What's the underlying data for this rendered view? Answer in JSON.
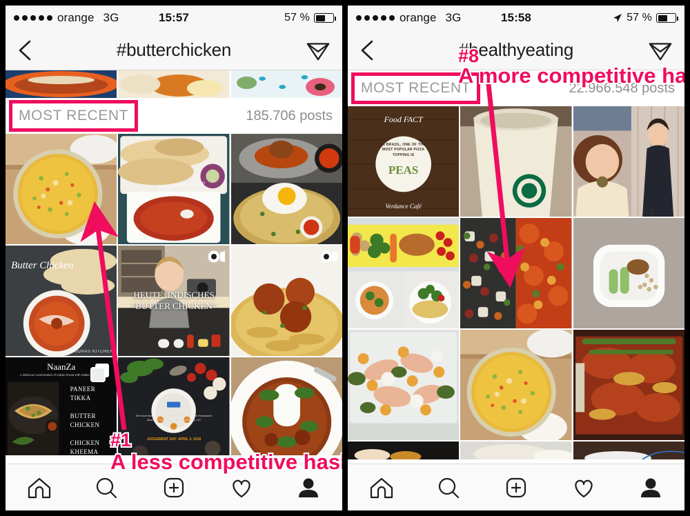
{
  "colors": {
    "accent": "#ef0d5e",
    "bezel": "#000000",
    "chrome": "#f7f7f7",
    "muted_text": "#8e8e8e",
    "tabbar": "#fafafa"
  },
  "panels": [
    {
      "id": "left",
      "status": {
        "signal_dots": 5,
        "carrier": "orange",
        "network": "3G",
        "time": "15:57",
        "battery_percent_label": "57 %",
        "battery_level": 57,
        "location_icon": false
      },
      "nav": {
        "back_icon": "chevron-left-icon",
        "title": "#butterchicken",
        "direct_icon": "paper-plane-icon"
      },
      "section": {
        "label": "MOST RECENT",
        "highlighted": true,
        "post_count": "185.706 posts"
      },
      "grid": [
        [
          {
            "alt": "yellow curry in glass bowl on wood table",
            "kind": "photo",
            "badge": ""
          },
          {
            "alt": "naan bread with butter chicken curry plate",
            "kind": "photo",
            "badge": "",
            "watermark": "@SUNNYSIDEUP"
          },
          {
            "alt": "fried egg over noodles with curry",
            "kind": "photo",
            "badge": ""
          }
        ],
        [
          {
            "alt": "butter chicken bowl with naan",
            "kind": "photo",
            "badge": "",
            "caption": "Butter Chicken",
            "watermark": "AMUDHAS KITCHEN"
          },
          {
            "alt": "woman in kitchen cooking video",
            "kind": "video",
            "badge": "video-badge",
            "caption": "HEUTE: INDISCHES \"BUTTER CHICKEN\""
          },
          {
            "alt": "chicken curry over rice",
            "kind": "video",
            "badge": "video-badge"
          }
        ],
        [
          {
            "alt": "NaanZa menu board",
            "kind": "carousel",
            "badge": "multi-badge",
            "caption": "NaanZa",
            "menu": [
              "PANEER TIKKA",
              "BUTTER CHICKEN",
              "CHICKEN KHEEMA"
            ],
            "subtitle": "A delicious combination of Indian bread with Indian toppings"
          },
          {
            "alt": "restaurant awards poster on slate",
            "kind": "photo",
            "badge": "",
            "caption": "the guide Restaurant Awards",
            "fineprint": "We have been shortlisted for Mid Day's The Guide Restaurant Awards 2018. Will we make it to the Top 10?",
            "judgement": "JUDGEMENT DAY: APRIL 3, 2018"
          },
          {
            "alt": "curry with rice tower and coriander",
            "kind": "photo",
            "badge": ""
          }
        ]
      ],
      "annotations": [
        {
          "number": "#1",
          "text": "A less competitive hashtag",
          "arrow": "points to top-left curry tile"
        }
      ]
    },
    {
      "id": "right",
      "status": {
        "signal_dots": 5,
        "carrier": "orange",
        "network": "3G",
        "time": "15:58",
        "battery_percent_label": "57 %",
        "battery_level": 57,
        "location_icon": true
      },
      "nav": {
        "back_icon": "chevron-left-icon",
        "title": "#healthyeating",
        "direct_icon": "paper-plane-icon"
      },
      "section": {
        "label": "MOST RECENT",
        "highlighted": true,
        "post_count": "22.966.548 posts"
      },
      "grid": [
        [
          {
            "alt": "Food FACT wooden board graphic",
            "kind": "photo",
            "badge": "",
            "caption": "Food FACT",
            "fact": "IN BRAZIL, ONE OF THE MOST POPULAR PIZZA TOPPING IS",
            "fact_word": "PEAS",
            "brand": "Verdance Café"
          },
          {
            "alt": "Starbucks coffee cup close up",
            "kind": "photo",
            "badge": ""
          },
          {
            "alt": "two women at a party",
            "kind": "photo",
            "badge": ""
          }
        ],
        [
          {
            "alt": "vegetables on yellow board and sweet potato plates",
            "kind": "photo",
            "badge": ""
          },
          {
            "alt": "bean salad and chili pot collage",
            "kind": "photo",
            "badge": ""
          },
          {
            "alt": "white plate with cucumber sticks and grains",
            "kind": "photo",
            "badge": ""
          }
        ],
        [
          {
            "alt": "ham salad meal prep container",
            "kind": "photo",
            "badge": ""
          },
          {
            "alt": "yellow curry in glass bowl on wood table",
            "kind": "photo",
            "badge": ""
          },
          {
            "alt": "baked salmon with asparagus tray",
            "kind": "photo",
            "badge": ""
          }
        ]
      ],
      "annotations": [
        {
          "number": "#8",
          "text": "A more competitive hashtag",
          "arrow": "points to centre curry tile"
        }
      ]
    }
  ],
  "tabbar": {
    "items": [
      {
        "name": "home-icon",
        "label": "Home"
      },
      {
        "name": "search-icon",
        "label": "Search"
      },
      {
        "name": "add-post-icon",
        "label": "Add"
      },
      {
        "name": "heart-icon",
        "label": "Activity"
      },
      {
        "name": "profile-icon",
        "label": "Profile"
      }
    ]
  }
}
